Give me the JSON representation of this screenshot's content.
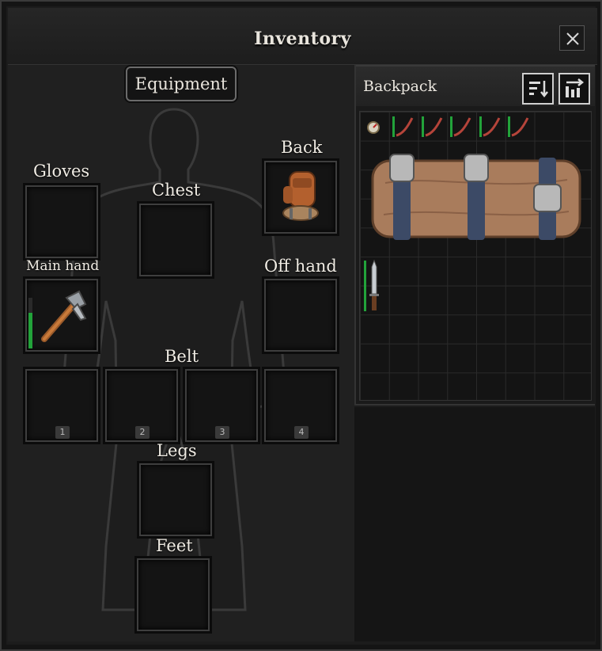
{
  "window": {
    "title": "Inventory"
  },
  "equipment": {
    "header": "Equipment",
    "slots": {
      "gloves": {
        "label": "Gloves",
        "item": null
      },
      "chest": {
        "label": "Chest",
        "item": null
      },
      "back": {
        "label": "Back",
        "item": "backpack-icon"
      },
      "main_hand": {
        "label": "Main hand",
        "item": "hatchet-icon",
        "durability": 0.7
      },
      "off_hand": {
        "label": "Off hand",
        "item": null
      },
      "belt": {
        "label": "Belt",
        "slots": [
          "1",
          "2",
          "3",
          "4"
        ]
      },
      "legs": {
        "label": "Legs",
        "item": null
      },
      "feet": {
        "label": "Feet",
        "item": null
      }
    }
  },
  "backpack": {
    "title": "Backpack",
    "buttons": [
      "sort-icon",
      "transfer-icon"
    ],
    "items": [
      {
        "name": "compass-icon"
      },
      {
        "name": "resource-stick-icon",
        "count": 5
      },
      {
        "name": "bedroll-icon"
      },
      {
        "name": "knife-icon"
      }
    ],
    "grid": {
      "columns": 8,
      "rows": 10
    }
  },
  "colors": {
    "durability": "#22a33a",
    "background": "#1c1c1c",
    "slot_border": "#3e3e3e"
  }
}
